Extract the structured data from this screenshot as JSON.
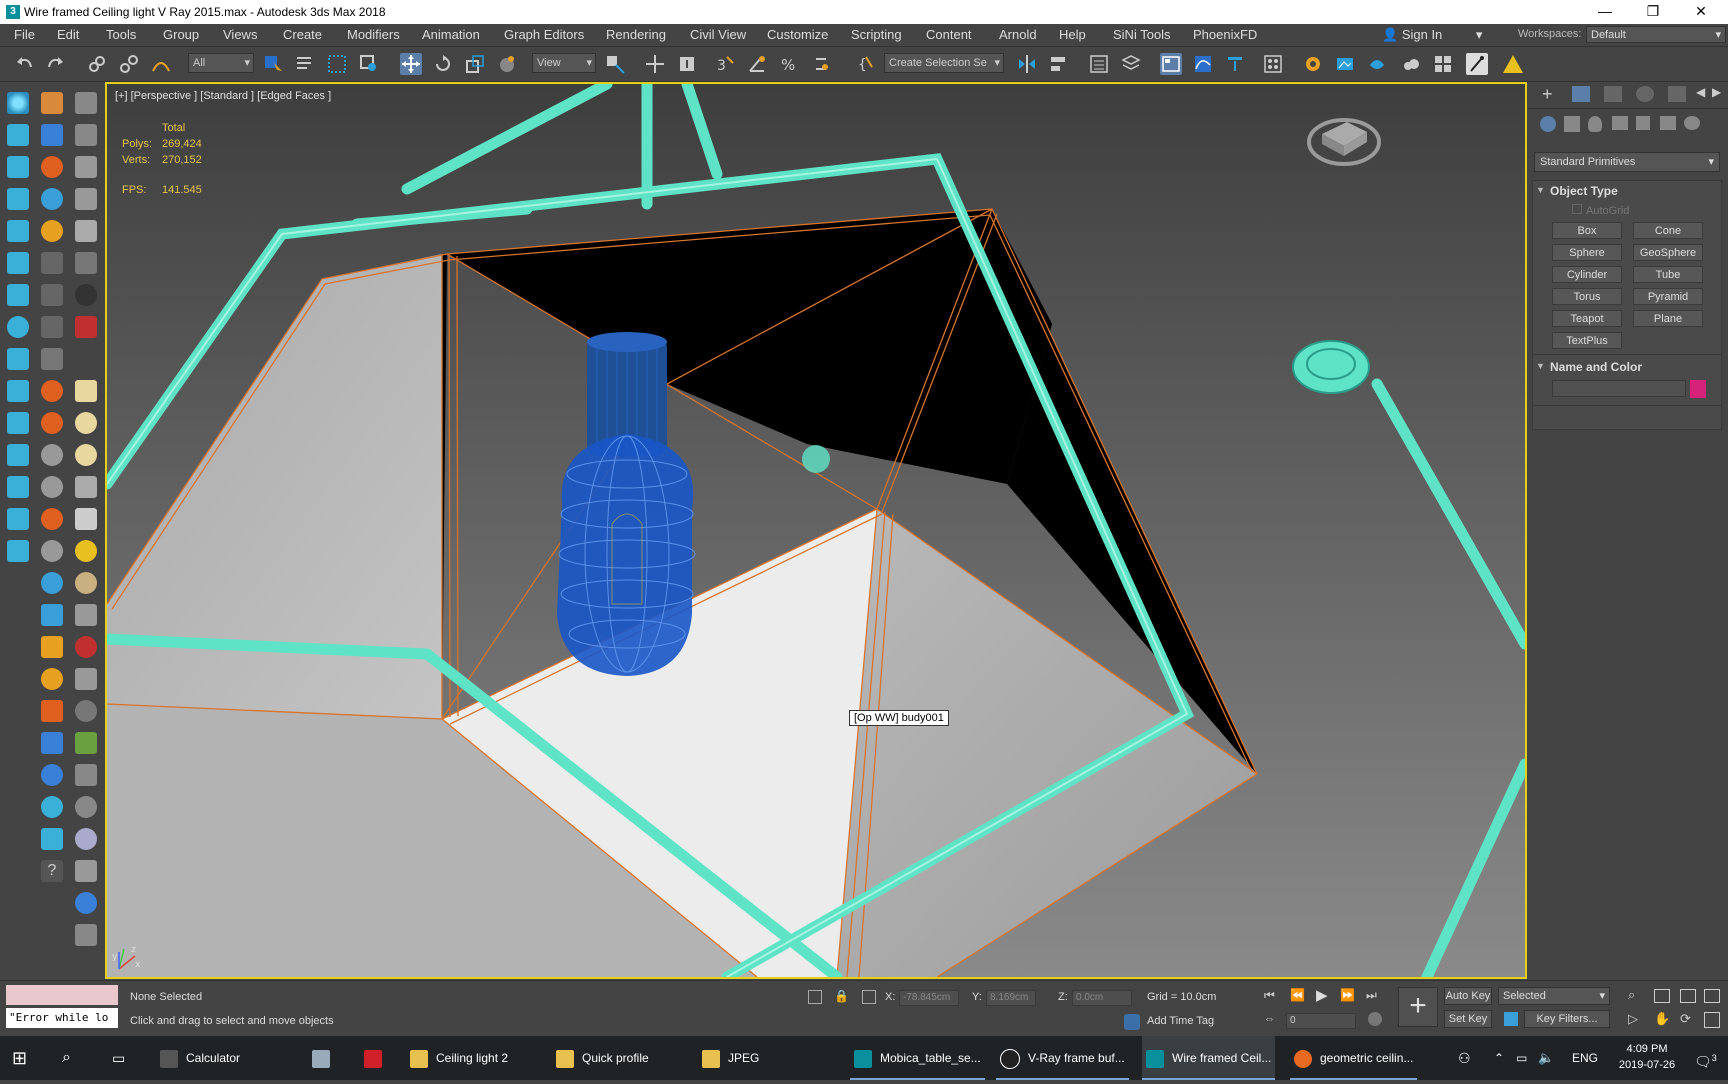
{
  "window": {
    "title": "Wire framed Ceiling light V Ray 2015.max - Autodesk 3ds Max 2018",
    "app_badge": "3",
    "controls": [
      "—",
      "❐",
      "✕"
    ]
  },
  "menu": [
    "File",
    "Edit",
    "Tools",
    "Group",
    "Views",
    "Create",
    "Modifiers",
    "Animation",
    "Graph Editors",
    "Rendering",
    "Civil View",
    "Customize",
    "Scripting",
    "Content",
    "Arnold",
    "Help",
    "SiNi Tools",
    "PhoenixFD"
  ],
  "account": {
    "sign_in": "Sign In",
    "workspaces_label": "Workspaces:",
    "workspace": "Default"
  },
  "toolbar": {
    "filter": "All",
    "coord_system": "View",
    "selection_set": "Create Selection Se"
  },
  "viewport": {
    "label": "[+] [Perspective ] [Standard ] [Edged Faces ]",
    "stats": {
      "header": "Total",
      "polys_label": "Polys:",
      "polys": "269,424",
      "verts_label": "Verts:",
      "verts": "270,152",
      "fps_label": "FPS:",
      "fps": "141.545"
    },
    "tooltip": "[Op WW] budy001",
    "axis_labels": {
      "x": "x",
      "y": "y",
      "z": "z"
    }
  },
  "command_panel": {
    "category": "Standard Primitives",
    "object_type_title": "Object Type",
    "autogrid": "AutoGrid",
    "buttons": [
      "Box",
      "Cone",
      "Sphere",
      "GeoSphere",
      "Cylinder",
      "Tube",
      "Torus",
      "Pyramid",
      "Teapot",
      "Plane",
      "TextPlus"
    ],
    "name_color_title": "Name and Color",
    "swatch_color": "#d6227a"
  },
  "status": {
    "script_output": "\"Error while lo",
    "selection": "None Selected",
    "prompt": "Click and drag to select and move objects",
    "x_label": "X:",
    "x_value": "-78.845cm",
    "y_label": "Y:",
    "y_value": "8.169cm",
    "z_label": "Z:",
    "z_value": "0.0cm",
    "grid": "Grid = 10.0cm",
    "add_time_tag": "Add Time Tag",
    "auto_key": "Auto Key",
    "set_key": "Set Key",
    "key_mode": "Selected",
    "frame": "0",
    "key_filters": "Key Filters..."
  },
  "taskbar": {
    "items": [
      "Calculator",
      "",
      "",
      "Ceiling light 2",
      "Quick profile",
      "JPEG",
      "Mobica_table_se...",
      "V-Ray frame buf...",
      "Wire framed Ceil...",
      "geometric ceilin..."
    ],
    "language": "ENG",
    "time": "4:09 PM",
    "date": "2019-07-26",
    "notifications": "3"
  },
  "colors": {
    "wire_cyan": "#5fe3c6",
    "bulb_blue": "#1a56c8",
    "edge_orange": "#d8742c",
    "viewport_border": "#e6cf17"
  }
}
